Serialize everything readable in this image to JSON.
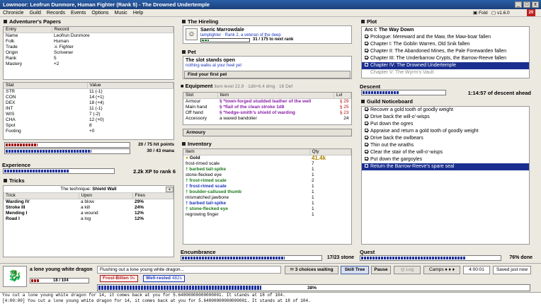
{
  "window": {
    "title": "Lowmoor: Leofrun Dunmore, Human Fighter (Rank 5) - The Drowned Undertemple",
    "min": "_",
    "max": "□",
    "close": "x"
  },
  "menu": [
    "Chronicle",
    "Guild",
    "Records",
    "Events",
    "Options",
    "Music",
    "Help"
  ],
  "topright": {
    "fold": "Fold",
    "version": "v1.6.0",
    "badge": "20"
  },
  "papers": {
    "header": "Adventurer's Papers",
    "cols": [
      "Entry",
      "Record"
    ],
    "rows": [
      [
        "Name",
        "Leofrun Dunmore"
      ],
      [
        "Folk",
        "Human"
      ],
      [
        "Trade",
        "Fighter"
      ],
      [
        "Origin",
        "Scrivener"
      ],
      [
        "Rank",
        "5"
      ],
      [
        "Mastery",
        "+2"
      ]
    ],
    "stat_cols": [
      "Stat",
      "Value"
    ],
    "stats": [
      [
        "STR",
        "11 (-1)"
      ],
      [
        "CON",
        "14 (+1)"
      ],
      [
        "DEX",
        "18 (+4)"
      ],
      [
        "INT",
        "11 (-1)"
      ],
      [
        "WIS",
        "7 (-2)"
      ],
      [
        "CHA",
        "12 (+0)"
      ],
      [
        "Spot",
        "8"
      ],
      [
        "Footing",
        "+0"
      ]
    ],
    "hp": {
      "text": "20 / 75 hit points",
      "value": 20,
      "max": 75
    },
    "mana": {
      "text": "30 / 43 mana",
      "value": 30,
      "max": 43
    }
  },
  "experience": {
    "header": "Experience",
    "text": "2.2k XP to rank 6",
    "fraction": 0.6
  },
  "tricks": {
    "header": "Tricks",
    "technique_label": "The technique:",
    "technique": "Shield Wall",
    "plus": "+",
    "cols": [
      "Trick",
      "Upon",
      "Fires"
    ],
    "rows": [
      [
        "Warding IV",
        "a blow",
        "29%"
      ],
      [
        "Stroke III",
        "a kill",
        "24%"
      ],
      [
        "Mending I",
        "a wound",
        "12%"
      ],
      [
        "Road I",
        "a log",
        "12%"
      ]
    ]
  },
  "hireling": {
    "header": "The Hireling",
    "name": "Saeric Marrowdale",
    "desc": "lamplighter · Rank 2, a veteran of the deep",
    "xp": "31 / 175 to next rank",
    "fraction": 0.18
  },
  "pet": {
    "header": "Pet",
    "title": "The slot stands open",
    "sub": "nothing walks at your heel yet",
    "button": "Find your first pet"
  },
  "equipment": {
    "header": "Equipment",
    "info": "item level 22.8 · 1d8+6.4 dmg · 16 Def",
    "cols": [
      "Slot",
      "Item",
      "Lvl"
    ],
    "rows": [
      {
        "slot": "Armour",
        "item": "§ *town-forged studded leather of the well",
        "lvl": "§ 29",
        "cls": "purple"
      },
      {
        "slot": "Main hand",
        "item": "§ *flail of the clean stroke 1d8",
        "lvl": "§ 25",
        "cls": "purple"
      },
      {
        "slot": "Off hand",
        "item": "§ *hedge-smith's shield of warding",
        "lvl": "§ 23",
        "cls": "purple"
      },
      {
        "slot": "Accessory",
        "item": "a waxed bandolier",
        "lvl": "24",
        "cls": ""
      }
    ],
    "armoury": "Armoury"
  },
  "inventory": {
    "header": "Inventory",
    "cols": [
      "Item",
      "Qty"
    ],
    "gold": {
      "name": "Gold",
      "qty": "41.4k"
    },
    "rows": [
      {
        "name": "frost-rimed scale",
        "qty": "7",
        "cls": ""
      },
      {
        "name": "† barbed tail-spike",
        "qty": "1",
        "cls": "green"
      },
      {
        "name": "stone-flecked eye",
        "qty": "1",
        "cls": ""
      },
      {
        "name": "† frost-rimed scale",
        "qty": "2",
        "cls": "green"
      },
      {
        "name": "† frost-rimed scale",
        "qty": "1",
        "cls": "blue"
      },
      {
        "name": "† boulder-callused thumb",
        "qty": "1",
        "cls": "green"
      },
      {
        "name": "mismatched jawbone",
        "qty": "1",
        "cls": ""
      },
      {
        "name": "† barbed tail-spike",
        "qty": "1",
        "cls": "blue"
      },
      {
        "name": "† stone-flecked eye",
        "qty": "1",
        "cls": "green"
      },
      {
        "name": "regrowing finger",
        "qty": "1",
        "cls": ""
      }
    ]
  },
  "encumbrance": {
    "header": "Encumbrance",
    "text": "17/23 stone",
    "fraction": 0.74
  },
  "plot": {
    "header": "Plot",
    "items": [
      {
        "label": "Arc I: The Way Down",
        "state": "head"
      },
      {
        "label": "Prologue: Mereward and the Maw, the Maw-boar fallen",
        "state": "done"
      },
      {
        "label": "Chapter I: The Goblin Warren, Old Snik fallen",
        "state": "done"
      },
      {
        "label": "Chapter II: The Abandoned Mines, the Pale Forewarden fallen",
        "state": "done"
      },
      {
        "label": "Chapter III: The Underbarrow Crypts, the Barrow-Reeve fallen",
        "state": "done"
      },
      {
        "label": "Chapter IV: The Drowned Undertemple",
        "state": "sel"
      },
      {
        "label": "Chapter V: The Wyrm's Vault",
        "state": "grey"
      }
    ]
  },
  "descent": {
    "header": "Descent",
    "text": "1:14:57 of descent ahead",
    "fraction": 0.45
  },
  "notice": {
    "header": "Guild Noticeboard",
    "items": [
      {
        "label": "Recover a gold tooth of goodly weight",
        "state": "done"
      },
      {
        "label": "Drive back the will-o'-wisps",
        "state": "done"
      },
      {
        "label": "Put down the ogres",
        "state": "done"
      },
      {
        "label": "Appraise and return a gold tooth of goodly weight",
        "state": "done"
      },
      {
        "label": "Drive back the owlbears",
        "state": "done"
      },
      {
        "label": "Thin out the wraiths",
        "state": "done"
      },
      {
        "label": "Clear the stair of the will-o'-wisps",
        "state": "done"
      },
      {
        "label": "Put down the gargoyles",
        "state": "done"
      },
      {
        "label": "Return the Barrow-Reeve's spare seal",
        "state": "sel"
      }
    ]
  },
  "quest": {
    "header": "Quest",
    "text": "76% done",
    "fraction": 0.76
  },
  "foe": {
    "name": "a lone young white dragon",
    "hp": "18 / 104",
    "fraction": 0.17
  },
  "status": {
    "flush": "Flushing out a lone young white dragon...",
    "frost": "Frost-Bitten",
    "frost_n": "9s",
    "rested": "Well-rested",
    "rested_n": "482s",
    "progress": "38%",
    "fraction": 0.38
  },
  "controls": {
    "choices": "3 choices waiting",
    "skill": "Skill Tree",
    "pause": "Pause",
    "log": "Log",
    "camps": "Camps",
    "time": "4:00:01",
    "saved": "Saved just now"
  },
  "log": [
    "You cut a lone young white dragon for 14, it comes back at you for 5.64000000000000001. It stands at 18 of 104.",
    "[4:00:00] You cut a lone young white dragon for 14, it comes back at you for 5.64000000000000001. It stands at 18 of 104."
  ]
}
